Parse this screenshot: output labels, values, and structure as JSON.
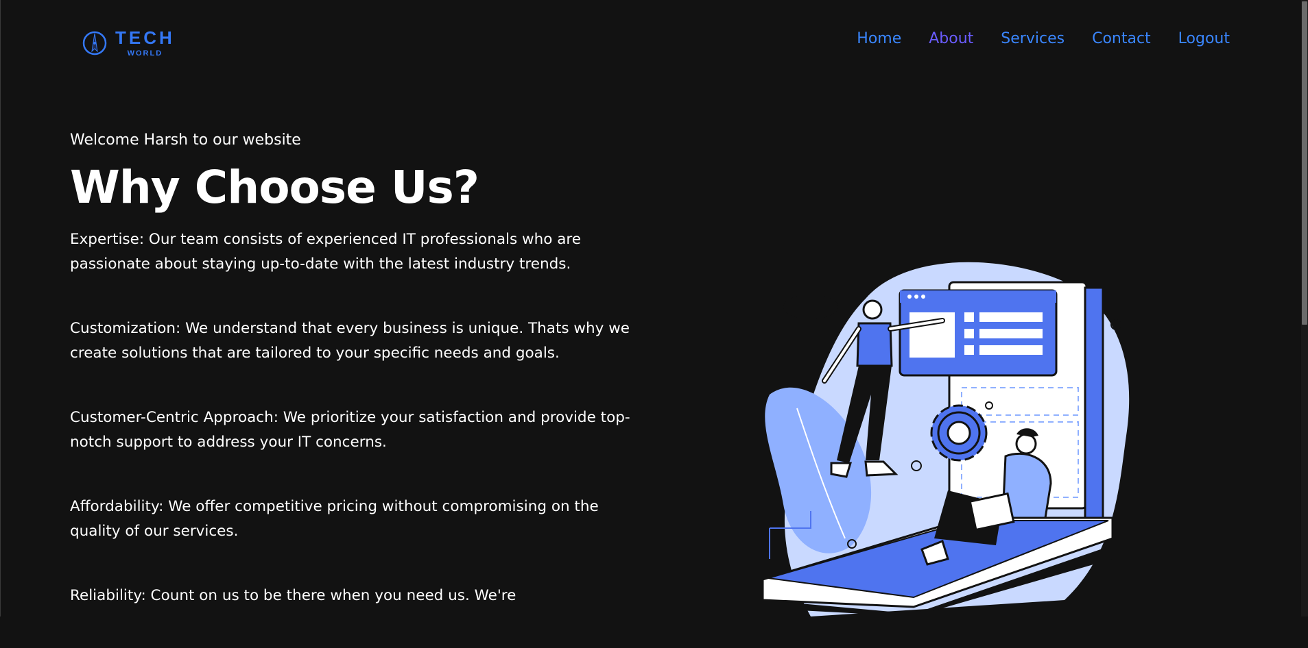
{
  "brand": {
    "name_line1": "TECH",
    "name_line2": "WORLD",
    "icon": "compass-logo-icon"
  },
  "nav": {
    "items": [
      {
        "label": "Home",
        "active": false
      },
      {
        "label": "About",
        "active": true
      },
      {
        "label": "Services",
        "active": false
      },
      {
        "label": "Contact",
        "active": false
      },
      {
        "label": "Logout",
        "active": false
      }
    ]
  },
  "main": {
    "welcome": "Welcome Harsh to our website",
    "title": "Why Choose Us?",
    "paragraphs": [
      "Expertise: Our team consists of experienced IT professionals who are passionate about staying up-to-date with the latest industry trends.",
      "Customization: We understand that every business is unique. Thats why we create solutions that are tailored to your specific needs and goals.",
      "Customer-Centric Approach: We prioritize your satisfaction and provide top-notch support to address your IT concerns.",
      "Affordability: We offer competitive pricing without compromising on the quality of our services.",
      "Reliability: Count on us to be there when you need us. We're"
    ]
  },
  "colors": {
    "background": "#121212",
    "nav_link": "#3a86ff",
    "nav_active": "#6a5cff",
    "brand": "#3478f6",
    "illustration_primary": "#4f74ef",
    "illustration_light": "#c9d9ff"
  }
}
